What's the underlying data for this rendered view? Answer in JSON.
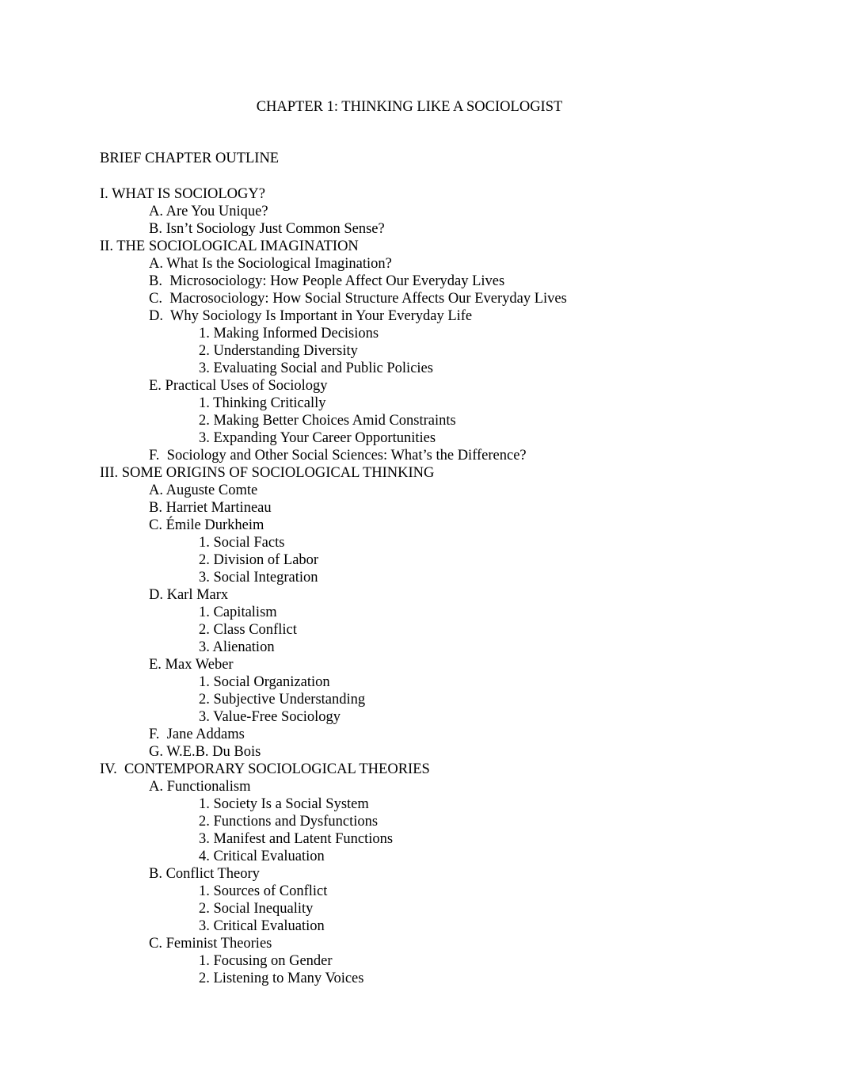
{
  "document": {
    "title": "CHAPTER 1: THINKING LIKE A SOCIOLOGIST",
    "subtitle": "BRIEF CHAPTER OUTLINE",
    "outline": [
      {
        "level": 0,
        "text": "I. WHAT IS SOCIOLOGY?"
      },
      {
        "level": 1,
        "text": "A. Are You Unique?"
      },
      {
        "level": 1,
        "text": "B. Isn’t Sociology Just Common Sense?"
      },
      {
        "level": 0,
        "text": "II. THE SOCIOLOGICAL IMAGINATION"
      },
      {
        "level": 1,
        "text": "A. What Is the Sociological Imagination?"
      },
      {
        "level": 1,
        "text": "B.  Microsociology: How People Affect Our Everyday Lives"
      },
      {
        "level": 1,
        "text": "C.  Macrosociology: How Social Structure Affects Our Everyday Lives"
      },
      {
        "level": 1,
        "text": "D.  Why Sociology Is Important in Your Everyday Life"
      },
      {
        "level": 2,
        "text": "1. Making Informed Decisions"
      },
      {
        "level": 2,
        "text": "2. Understanding Diversity"
      },
      {
        "level": 2,
        "text": "3. Evaluating Social and Public Policies"
      },
      {
        "level": 1,
        "text": "E. Practical Uses of Sociology"
      },
      {
        "level": 2,
        "text": "1. Thinking Critically"
      },
      {
        "level": 2,
        "text": "2. Making Better Choices Amid Constraints"
      },
      {
        "level": 2,
        "text": "3. Expanding Your Career Opportunities"
      },
      {
        "level": 1,
        "text": "F.  Sociology and Other Social Sciences: What’s the Difference?"
      },
      {
        "level": 0,
        "text": "III. SOME ORIGINS OF SOCIOLOGICAL THINKING"
      },
      {
        "level": 1,
        "text": "A. Auguste Comte"
      },
      {
        "level": 1,
        "text": "B. Harriet Martineau"
      },
      {
        "level": 1,
        "text": "C. Émile Durkheim"
      },
      {
        "level": 2,
        "text": "1. Social Facts"
      },
      {
        "level": 2,
        "text": "2. Division of Labor"
      },
      {
        "level": 2,
        "text": "3. Social Integration"
      },
      {
        "level": 1,
        "text": "D. Karl Marx"
      },
      {
        "level": 2,
        "text": "1. Capitalism"
      },
      {
        "level": 2,
        "text": "2. Class Conflict"
      },
      {
        "level": 2,
        "text": "3. Alienation"
      },
      {
        "level": 1,
        "text": "E. Max Weber"
      },
      {
        "level": 2,
        "text": "1. Social Organization"
      },
      {
        "level": 2,
        "text": "2. Subjective Understanding"
      },
      {
        "level": 2,
        "text": "3. Value-Free Sociology"
      },
      {
        "level": 1,
        "text": "F.  Jane Addams"
      },
      {
        "level": 1,
        "text": "G. W.E.B. Du Bois"
      },
      {
        "level": 0,
        "text": "IV.  CONTEMPORARY SOCIOLOGICAL THEORIES"
      },
      {
        "level": 1,
        "text": "A. Functionalism"
      },
      {
        "level": 2,
        "text": "1. Society Is a Social System"
      },
      {
        "level": 2,
        "text": "2. Functions and Dysfunctions"
      },
      {
        "level": 2,
        "text": "3. Manifest and Latent Functions"
      },
      {
        "level": 2,
        "text": "4. Critical Evaluation"
      },
      {
        "level": 1,
        "text": "B. Conflict Theory"
      },
      {
        "level": 2,
        "text": "1. Sources of Conflict"
      },
      {
        "level": 2,
        "text": "2. Social Inequality"
      },
      {
        "level": 2,
        "text": "3. Critical Evaluation"
      },
      {
        "level": 1,
        "text": "C. Feminist Theories"
      },
      {
        "level": 2,
        "text": "1. Focusing on Gender"
      },
      {
        "level": 2,
        "text": "2. Listening to Many Voices"
      }
    ]
  }
}
